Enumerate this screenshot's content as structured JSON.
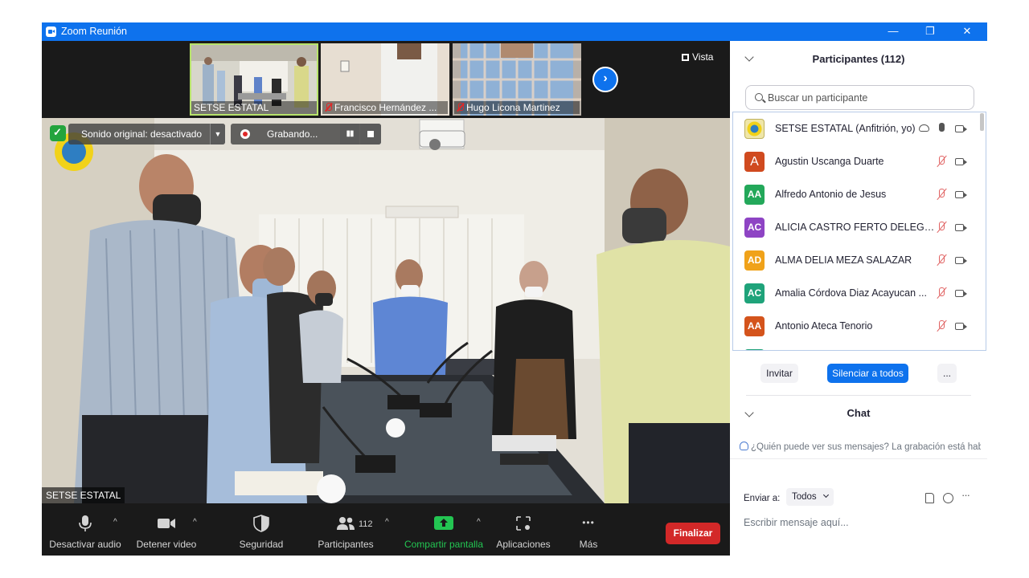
{
  "window": {
    "title": "Zoom Reunión",
    "minimize_glyph": "—",
    "restore_glyph": "❐",
    "close_glyph": "✕"
  },
  "gallery": {
    "thumbnails": [
      {
        "name": "SETSE ESTATAL",
        "muted": false,
        "active": true
      },
      {
        "name": "Francisco Hernández ...",
        "muted": true,
        "active": false
      },
      {
        "name": "Hugo Licona Martinez",
        "muted": true,
        "active": false
      }
    ],
    "next_glyph": "›",
    "view_label": "Vista"
  },
  "video": {
    "speaker_name": "SETSE ESTATAL",
    "original_sound_label": "Sonido original: desactivado",
    "recording_label": "Grabando...",
    "pause_glyph": "▮▮"
  },
  "toolbar": {
    "mute_label": "Desactivar audio",
    "video_label": "Detener video",
    "security_label": "Seguridad",
    "participants_label": "Participantes",
    "participants_count": "112",
    "share_label": "Compartir pantalla",
    "apps_label": "Aplicaciones",
    "more_label": "Más",
    "end_label": "Finalizar",
    "caret_glyph": "^",
    "more_glyph": "•••"
  },
  "participants_panel": {
    "title": "Participantes (112)",
    "search_placeholder": "Buscar un participante",
    "participants": [
      {
        "initials": "",
        "name": "SETSE ESTATAL (Anfitrión, yo)",
        "color": "#e8e0a0",
        "host": true,
        "mic_on": true
      },
      {
        "initials": "A",
        "name": "Agustin Uscanga Duarte",
        "color": "#d04a1f",
        "host": false,
        "mic_on": false
      },
      {
        "initials": "AA",
        "name": "Alfredo Antonio de Jesus",
        "color": "#23a85a",
        "host": false,
        "mic_on": false
      },
      {
        "initials": "AC",
        "name": "ALICIA CASTRO FERTO DELEGAC...",
        "color": "#8e44c4",
        "host": false,
        "mic_on": false
      },
      {
        "initials": "AD",
        "name": "ALMA DELIA MEZA SALAZAR",
        "color": "#f0a21a",
        "host": false,
        "mic_on": false
      },
      {
        "initials": "AC",
        "name": "Amalia Córdova Diaz Acayucan ...",
        "color": "#1fa37a",
        "host": false,
        "mic_on": false
      },
      {
        "initials": "AA",
        "name": "Antonio Ateca Tenorio",
        "color": "#d4541c",
        "host": false,
        "mic_on": false
      }
    ],
    "invite_label": "Invitar",
    "mute_all_label": "Silenciar a todos",
    "more_label": "..."
  },
  "chat": {
    "title": "Chat",
    "notice": "¿Quién puede ver sus mensajes? La grabación está habilitada",
    "send_to_label": "Enviar a:",
    "send_to_value": "Todos",
    "input_placeholder": "Escribir mensaje aquí...",
    "more_glyph": "···"
  }
}
